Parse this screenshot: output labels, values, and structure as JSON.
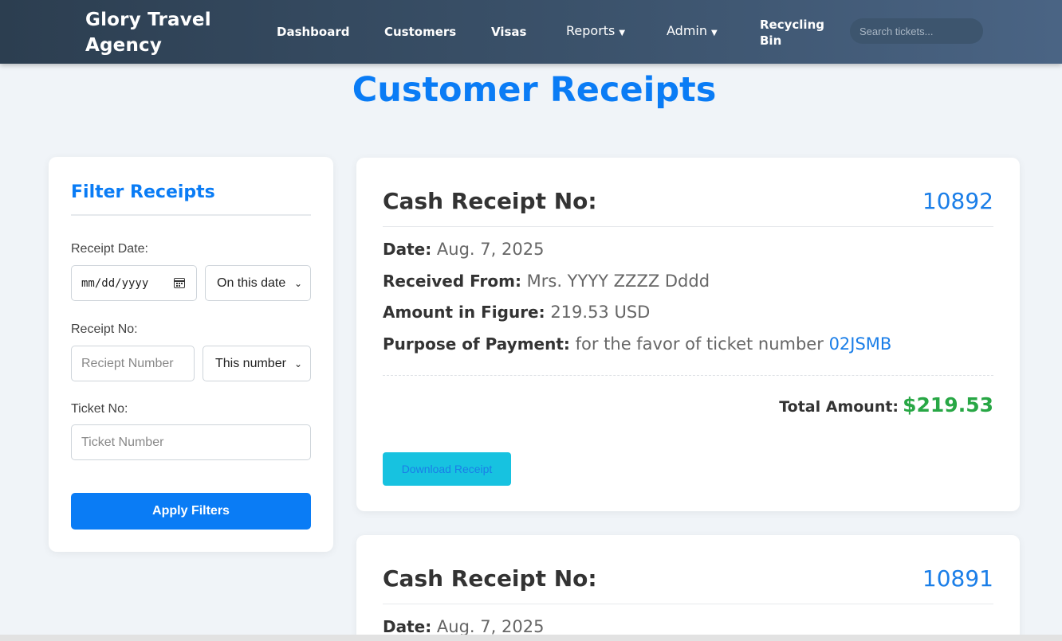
{
  "nav": {
    "brand": "Glory Travel Agency",
    "items": [
      {
        "label": "Dashboard"
      },
      {
        "label": "Customers"
      },
      {
        "label": "Visas"
      },
      {
        "label": "Reports",
        "caret": "▼"
      },
      {
        "label": "Admin",
        "caret": "▼"
      },
      {
        "label": "Recycling Bin"
      }
    ],
    "search_placeholder": "Search tickets..."
  },
  "page": {
    "title": "Customer Receipts"
  },
  "filters": {
    "title": "Filter Receipts",
    "receipt_date_label": "Receipt Date:",
    "date_placeholder": "mm/dd/yyyy",
    "date_mode": "On this date",
    "receipt_no_label": "Receipt No:",
    "receipt_no_placeholder": "Reciept Number",
    "receipt_no_mode": "This number",
    "ticket_no_label": "Ticket No:",
    "ticket_no_placeholder": "Ticket Number",
    "apply_label": "Apply Filters"
  },
  "receipts": [
    {
      "heading": "Cash Receipt No:",
      "number": "10892",
      "date_label": "Date:",
      "date": "Aug. 7, 2025",
      "from_label": "Received From:",
      "from": "Mrs. YYYY ZZZZ Dddd",
      "amount_label": "Amount in Figure:",
      "amount": "219.53 USD",
      "purpose_label": "Purpose of Payment:",
      "purpose": "for the favor of ticket number",
      "ticket": "02JSMB",
      "total_label": "Total Amount:",
      "total": "$219.53",
      "download_label": "Download Receipt"
    },
    {
      "heading": "Cash Receipt No:",
      "number": "10891",
      "date_label": "Date:",
      "date": "Aug. 7, 2025"
    }
  ],
  "colors": {
    "accent": "#0a7cf5",
    "nav_bg": "#34495e",
    "total_green": "#28a745",
    "download_bg": "#17c2e0"
  },
  "icons": [
    "calendar-icon",
    "chevron-down-icon"
  ]
}
